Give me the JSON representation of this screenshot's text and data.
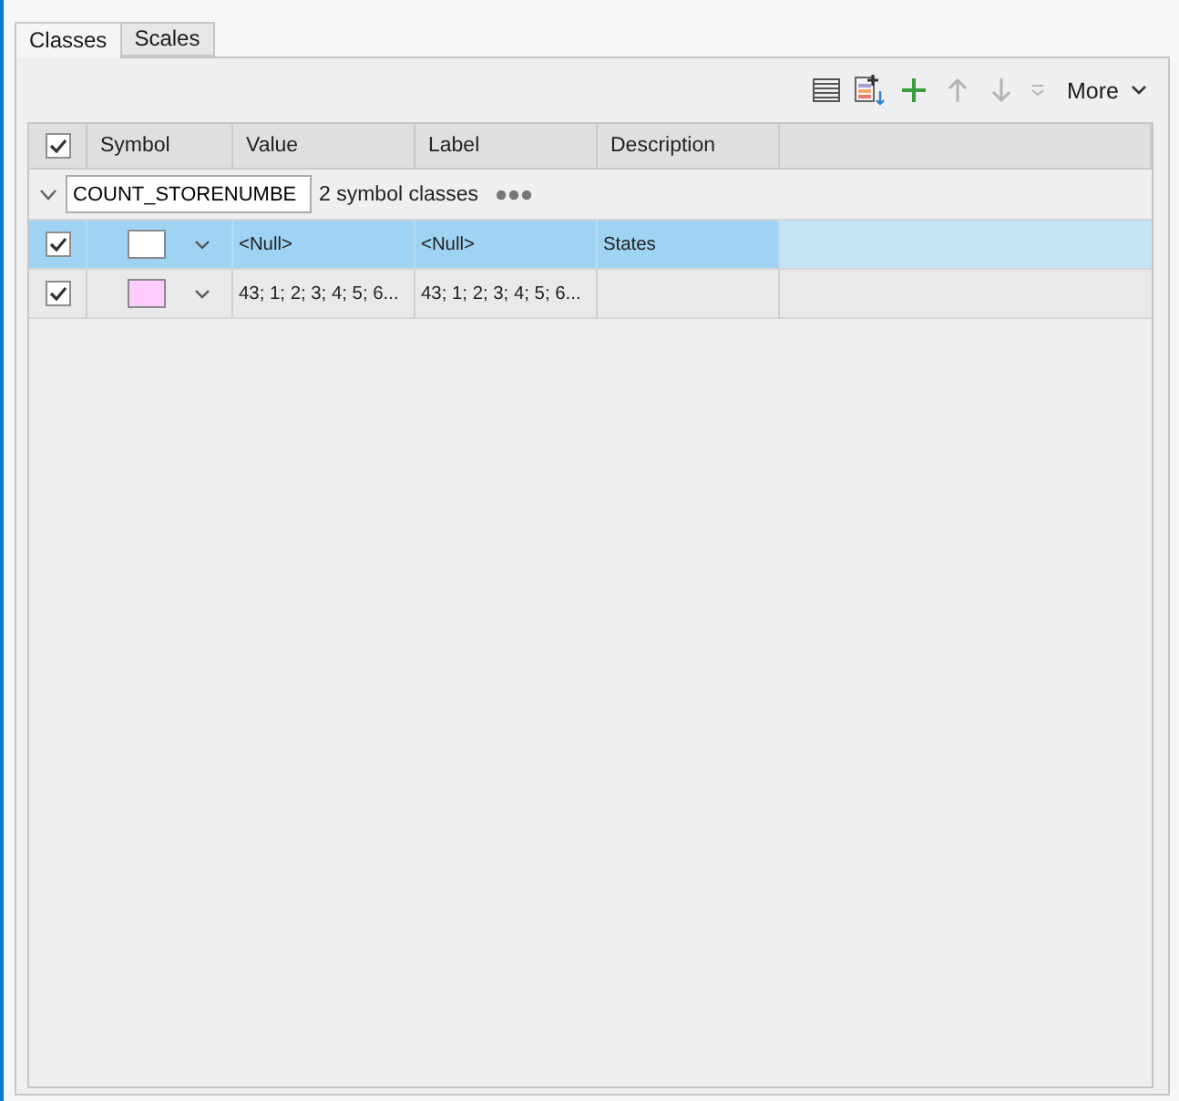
{
  "tabs": [
    {
      "label": "Classes",
      "selected": true
    },
    {
      "label": "Scales",
      "selected": false
    }
  ],
  "toolbar": {
    "buttons": [
      {
        "kind": "list",
        "disabled": false
      },
      {
        "kind": "add-from-list",
        "disabled": false
      },
      {
        "kind": "add",
        "disabled": false
      },
      {
        "kind": "up",
        "disabled": true
      },
      {
        "kind": "down",
        "disabled": true
      },
      {
        "kind": "collapse",
        "disabled": true
      }
    ],
    "more_menu": {
      "label": "More"
    }
  },
  "table": {
    "header_checked": true,
    "columns": [
      {
        "label": "Symbol"
      },
      {
        "label": "Value"
      },
      {
        "label": "Label"
      },
      {
        "label": "Description"
      }
    ],
    "group": {
      "expanded": true,
      "field": {
        "value": "COUNT_STORENUMBE"
      },
      "summary": "2 symbol classes"
    },
    "rows": [
      {
        "checked": true,
        "selected": true,
        "color": "#ffffff",
        "value": "<Null>",
        "label": "<Null>",
        "description": "States"
      },
      {
        "checked": true,
        "selected": false,
        "color": "#ffccff",
        "value": "43; 1; 2; 3; 4; 5; 6...",
        "label": "43; 1; 2; 3; 4; 5; 6..."
      }
    ]
  }
}
